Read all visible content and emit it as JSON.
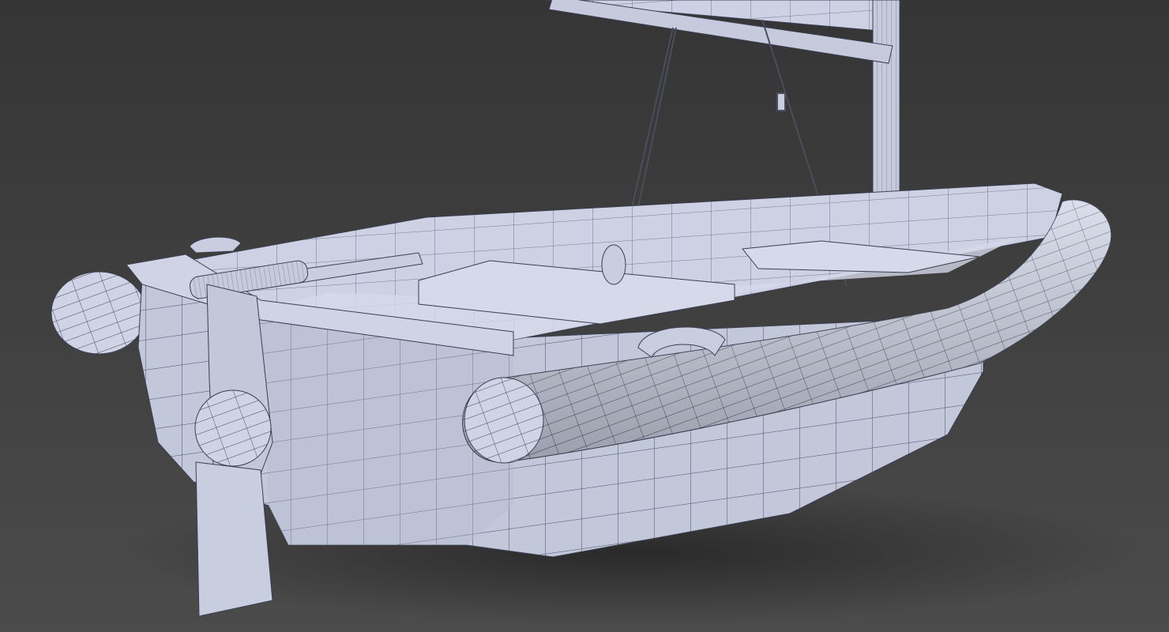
{
  "colors": {
    "background_top": "#363636",
    "background_bottom": "#4a4a4a",
    "model": "#c9cde0",
    "model_shade": "#a9aec4",
    "model_dark": "#8d92a8",
    "wire": "#3a3e50",
    "rope": "#4a4d5c"
  }
}
